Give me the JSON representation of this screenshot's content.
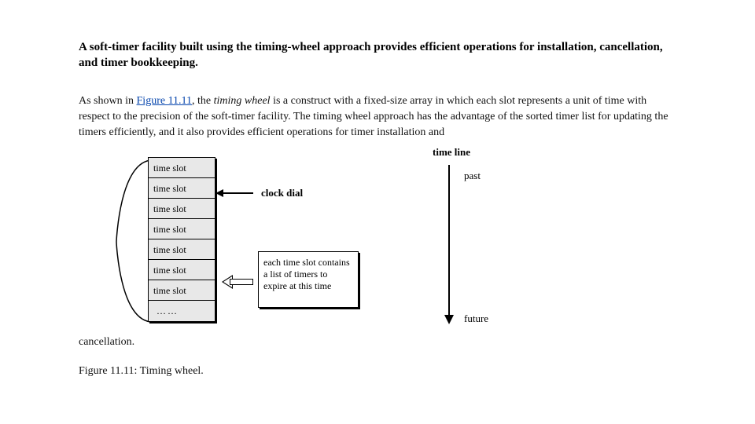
{
  "title": "A soft-timer facility built using the timing-wheel approach provides efficient operations for installation, cancellation, and timer bookkeeping.",
  "paragraph": {
    "lead": "As shown in ",
    "figlink": "Figure 11.11",
    "after_link": ", the ",
    "italic": "timing wheel",
    "tail": " is a construct with a fixed-size array in which each slot represents a unit of time with respect to the precision of the soft-timer facility. The timing wheel approach has the advantage of the sorted timer list for updating the timers efficiently, and it also provides efficient operations for timer installation and"
  },
  "dangling": "cancellation.",
  "caption": "Figure 11.11: Timing wheel.",
  "diagram": {
    "slots": [
      "time slot",
      "time slot",
      "time slot",
      "time slot",
      "time slot",
      "time slot",
      "time slot",
      "……"
    ],
    "clock_dial": "clock dial",
    "note": "each time slot contains a list of timers to expire at this time",
    "timeline_label": "time line",
    "past": "past",
    "future": "future"
  }
}
